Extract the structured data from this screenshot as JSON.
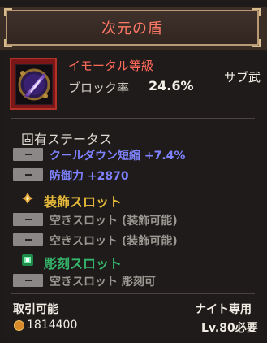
{
  "title": "次元の盾",
  "item": {
    "rarity": "イモータル等級",
    "stat_label": "ブロック率",
    "stat_value": "24.6%",
    "category": "サブ武"
  },
  "inherent": {
    "heading": "固有ステータス",
    "stats": [
      "クールダウン短縮 +7.4%",
      "防御力 +2870"
    ]
  },
  "ornament_slots": {
    "heading": "装飾スロット",
    "items": [
      "空きスロット (装飾可能)",
      "空きスロット (装飾可能)"
    ]
  },
  "engrave_slots": {
    "heading": "彫刻スロット",
    "items": [
      "空きスロット 彫刻可"
    ]
  },
  "footer": {
    "tradable": "取引可能",
    "class_restriction": "ナイト専用",
    "price": "1814400",
    "level_req": "Lv.80必要"
  },
  "colors": {
    "title": "#ff7a66",
    "rarity": "#ff6a5a",
    "stat_blue": "#7e82ff",
    "ornament_gold": "#e4b83a",
    "engrave_green": "#35b46a"
  },
  "icons": {
    "item": "dimensional-shield-icon",
    "ornament": "ornament-gem-icon",
    "engrave": "engrave-gem-icon",
    "coin": "gold-coin-icon",
    "minus": "minus-icon"
  }
}
